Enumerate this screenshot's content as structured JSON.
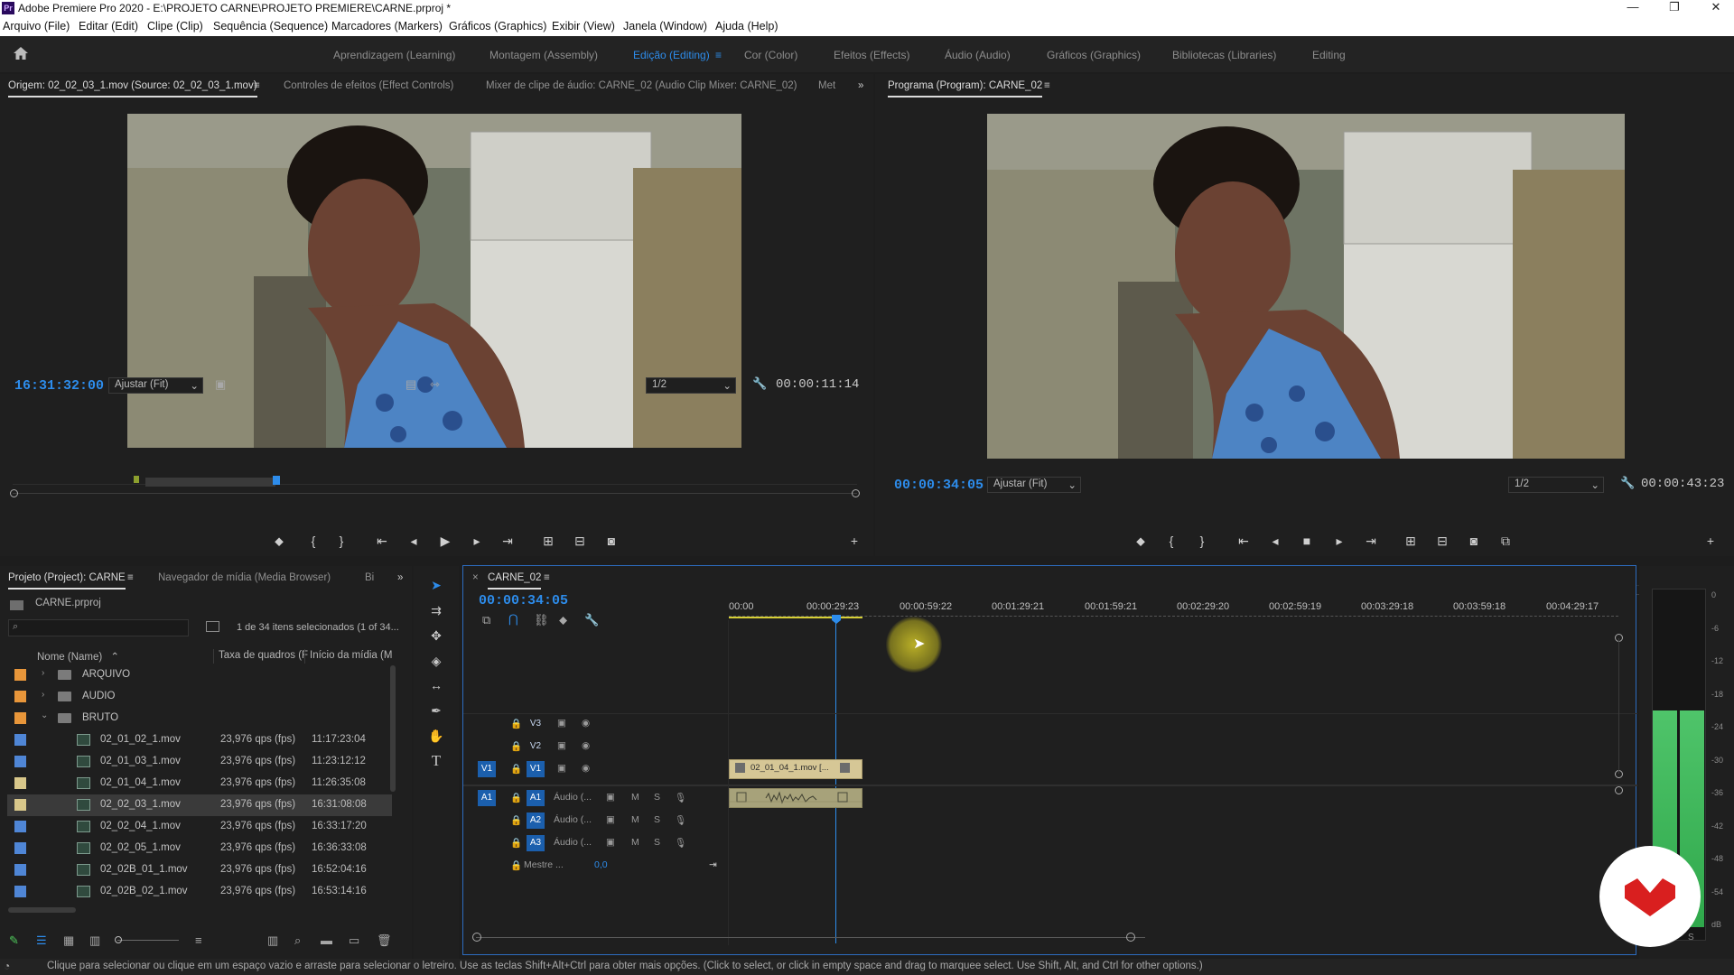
{
  "window": {
    "app_badge": "Pr",
    "title": "Adobe Premiere Pro 2020 - E:\\PROJETO CARNE\\PROJETO PREMIERE\\CARNE.prproj *",
    "minimize": "—",
    "maximize": "❐",
    "close": "✕"
  },
  "menu": [
    "Arquivo (File)",
    "Editar (Edit)",
    "Clipe (Clip)",
    "Sequência (Sequence)",
    "Marcadores (Markers)",
    "Gráficos (Graphics)",
    "Exibir (View)",
    "Janela (Window)",
    "Ajuda (Help)"
  ],
  "workspaces": [
    "Aprendizagem (Learning)",
    "Montagem (Assembly)",
    "Edição (Editing)",
    "Cor (Color)",
    "Efeitos (Effects)",
    "Áudio (Audio)",
    "Gráficos (Graphics)",
    "Bibliotecas (Libraries)",
    "Editing"
  ],
  "source_panel": {
    "tabs": [
      "Origem: 02_02_03_1.mov (Source: 02_02_03_1.mov)",
      "Controles de efeitos (Effect Controls)",
      "Mixer de clipe de áudio: CARNE_02 (Audio Clip Mixer: CARNE_02)",
      "Met"
    ],
    "timecode": "16:31:32:00",
    "fit": "Ajustar (Fit)",
    "resolution": "1/2",
    "duration": "00:00:11:14"
  },
  "program_panel": {
    "tab": "Programa (Program): CARNE_02",
    "timecode": "00:00:34:05",
    "fit": "Ajustar (Fit)",
    "resolution": "1/2",
    "duration": "00:00:43:23"
  },
  "project_panel": {
    "tabs": [
      "Projeto (Project): CARNE",
      "Navegador de mídia (Media Browser)",
      "Bi"
    ],
    "project_file": "CARNE.prproj",
    "selection_count": "1 de 34 itens selecionados (1 of 34...",
    "columns": {
      "name": "Nome (Name)",
      "fps": "Taxa de quadros (F",
      "start": "Início da mídia (M"
    },
    "folders": [
      {
        "name": "ARQUIVO",
        "color": "#e8963a"
      },
      {
        "name": "AUDIO",
        "color": "#e8963a"
      },
      {
        "name": "BRUTO",
        "color": "#e8963a"
      }
    ],
    "clips": [
      {
        "name": "02_01_02_1.mov",
        "fps": "23,976 qps (fps)",
        "start": "11:17:23:04",
        "color": "#4f86d6"
      },
      {
        "name": "02_01_03_1.mov",
        "fps": "23,976 qps (fps)",
        "start": "11:23:12:12",
        "color": "#4f86d6"
      },
      {
        "name": "02_01_04_1.mov",
        "fps": "23,976 qps (fps)",
        "start": "11:26:35:08",
        "color": "#d8c78a"
      },
      {
        "name": "02_02_03_1.mov",
        "fps": "23,976 qps (fps)",
        "start": "16:31:08:08",
        "color": "#d8c78a"
      },
      {
        "name": "02_02_04_1.mov",
        "fps": "23,976 qps (fps)",
        "start": "16:33:17:20",
        "color": "#4f86d6"
      },
      {
        "name": "02_02_05_1.mov",
        "fps": "23,976 qps (fps)",
        "start": "16:36:33:08",
        "color": "#4f86d6"
      },
      {
        "name": "02_02B_01_1.mov",
        "fps": "23,976 qps (fps)",
        "start": "16:52:04:16",
        "color": "#4f86d6"
      },
      {
        "name": "02_02B_02_1.mov",
        "fps": "23,976 qps (fps)",
        "start": "16:53:14:16",
        "color": "#4f86d6"
      }
    ]
  },
  "timeline": {
    "tab": "CARNE_02",
    "timecode": "00:00:34:05",
    "ruler": [
      "00:00",
      "00:00:29:23",
      "00:00:59:22",
      "00:01:29:21",
      "00:01:59:21",
      "00:02:29:20",
      "00:02:59:19",
      "00:03:29:18",
      "00:03:59:18",
      "00:04:29:17"
    ],
    "video_tracks": [
      "V3",
      "V2",
      "V1"
    ],
    "source_v": "V1",
    "source_a": "A1",
    "audio_tracks": [
      {
        "id": "A1",
        "name": "Áudio (..."
      },
      {
        "id": "A2",
        "name": "Áudio (..."
      },
      {
        "id": "A3",
        "name": "Áudio (..."
      }
    ],
    "mute": "M",
    "solo": "S",
    "master": {
      "name": "Mestre ...",
      "value": "0,0"
    },
    "clip_name": "02_01_04_1.mov [..."
  },
  "meter": {
    "scale": [
      "0",
      "-6",
      "-12",
      "-18",
      "-24",
      "-30",
      "-36",
      "-42",
      "-48",
      "-54",
      "dB"
    ],
    "solo_labels": [
      "S",
      "S"
    ]
  },
  "status": "Clique para selecionar ou clique em um espaço vazio e arraste para selecionar o letreiro. Use as teclas Shift+Alt+Ctrl para obter mais opções. (Click to select, or click in empty space and drag to marquee select. Use Shift, Alt, and Ctrl for other options.)"
}
